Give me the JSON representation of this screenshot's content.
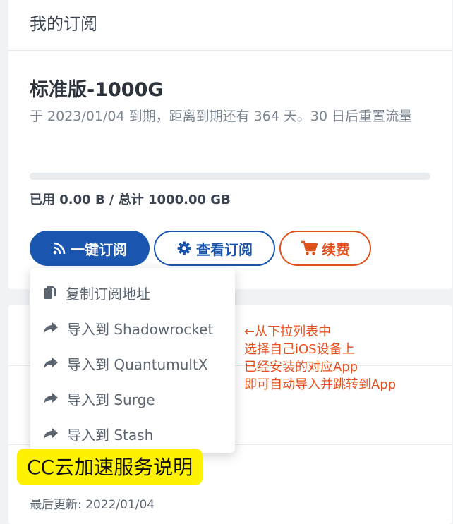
{
  "header": {
    "title": "我的订阅"
  },
  "plan": {
    "name": "标准版-1000G",
    "expire_text": "于 2023/01/04 到期，距离到期还有 364 天。30 日后重置流量",
    "usage_text": "已用 0.00 B / 总计 1000.00 GB",
    "usage_fraction": 0.0
  },
  "buttons": {
    "one_click": "一键订阅",
    "view": "查看订阅",
    "renew": "续费"
  },
  "dropdown": {
    "items": [
      {
        "label": "复制订阅地址",
        "icon": "copy-icon"
      },
      {
        "label": "导入到 Shadowrocket",
        "icon": "share-arrow-icon"
      },
      {
        "label": "导入到 QuantumultX",
        "icon": "share-arrow-icon"
      },
      {
        "label": "导入到 Surge",
        "icon": "share-arrow-icon"
      },
      {
        "label": "导入到 Stash",
        "icon": "share-arrow-icon"
      }
    ]
  },
  "annotation": {
    "lines": [
      "←从下拉列表中",
      "选择自己iOS设备上",
      "已经安装的对应App",
      "即可自动导入并跳转到App"
    ],
    "color": "#e8501e"
  },
  "overlay_label": "CC云加速服务说明",
  "footer": {
    "last_update": "最后更新: 2022/01/04"
  },
  "colors": {
    "primary": "#1a56b0",
    "renew": "#e0521c",
    "highlight": "#fff200"
  }
}
